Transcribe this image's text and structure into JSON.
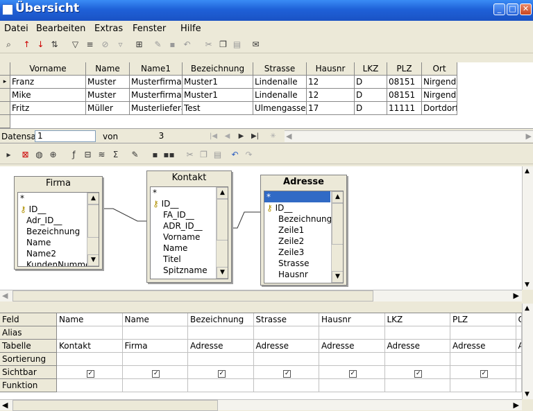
{
  "window": {
    "title": "Übersicht",
    "min_glyph": "_",
    "max_glyph": "□",
    "close_glyph": "✕"
  },
  "menu": [
    "Datei",
    "Bearbeiten",
    "Extras",
    "Fenster",
    "Hilfe"
  ],
  "toolbar1_icons": [
    "binoculars-icon",
    "sort-ascending-icon",
    "sort-descending-icon",
    "autofilter-icon",
    "standard-filter-icon",
    "apply-filter-icon",
    "remove-filter-icon",
    "filter-toggle-icon",
    "datasource-icon",
    "edit-data-icon",
    "save-record-icon",
    "undo-record-icon",
    "cut-icon",
    "copy-icon",
    "paste-icon",
    "form-letter-icon"
  ],
  "grid": {
    "columns": [
      "Vorname",
      "Name",
      "Name1",
      "Bezeichnung",
      "Strasse",
      "Hausnr",
      "LKZ",
      "PLZ",
      "Ort"
    ],
    "rows": [
      [
        "Franz",
        "Muster",
        "Musterfirma",
        "Muster1",
        "Lindenalle",
        "12",
        "D",
        "08151",
        "Nirgendwo"
      ],
      [
        "Mike",
        "Muster",
        "Musterfirma",
        "Muster1",
        "Lindenalle",
        "12",
        "D",
        "08151",
        "Nirgendwo"
      ],
      [
        "Fritz",
        "Müller",
        "Musterlieferant",
        "Test",
        "Ulmengasse",
        "17",
        "D",
        "11111",
        "Dortdorf"
      ]
    ]
  },
  "navigation": {
    "label": "Datensatz",
    "record": "1",
    "of_label": "von",
    "total": "3"
  },
  "tables": [
    {
      "title": "Firma",
      "fields": [
        "*",
        "ID__",
        "Adr_ID__",
        "Bezeichnung",
        "Name",
        "Name2",
        "KundenNummer"
      ],
      "key_index": 1
    },
    {
      "title": "Kontakt",
      "fields": [
        "*",
        "ID__",
        "FA_ID__",
        "ADR_ID__",
        "Vorname",
        "Name",
        "Titel",
        "Spitzname"
      ],
      "key_index": 1
    },
    {
      "title": "Adresse",
      "fields": [
        "*",
        "ID__",
        "Bezeichnung",
        "Zeile1",
        "Zeile2",
        "Zeile3",
        "Strasse",
        "Hausnr"
      ],
      "key_index": 1,
      "selected_index": 0
    }
  ],
  "query": {
    "row_labels": [
      "Feld",
      "Alias",
      "Tabelle",
      "Sortierung",
      "Sichtbar",
      "Funktion"
    ],
    "columns": [
      {
        "feld": "Name",
        "tabelle": "Kontakt",
        "sichtbar": true
      },
      {
        "feld": "Name",
        "tabelle": "Firma",
        "sichtbar": true
      },
      {
        "feld": "Bezeichnung",
        "tabelle": "Adresse",
        "sichtbar": true
      },
      {
        "feld": "Strasse",
        "tabelle": "Adresse",
        "sichtbar": true
      },
      {
        "feld": "Hausnr",
        "tabelle": "Adresse",
        "sichtbar": true
      },
      {
        "feld": "LKZ",
        "tabelle": "Adresse",
        "sichtbar": true
      },
      {
        "feld": "PLZ",
        "tabelle": "Adresse",
        "sichtbar": true
      },
      {
        "feld": "C",
        "tabelle": "A",
        "sichtbar": false
      }
    ]
  },
  "colors": {
    "titlebar": "#1f61d8",
    "selection": "#316ac5",
    "window_bg": "#ece9d8"
  }
}
